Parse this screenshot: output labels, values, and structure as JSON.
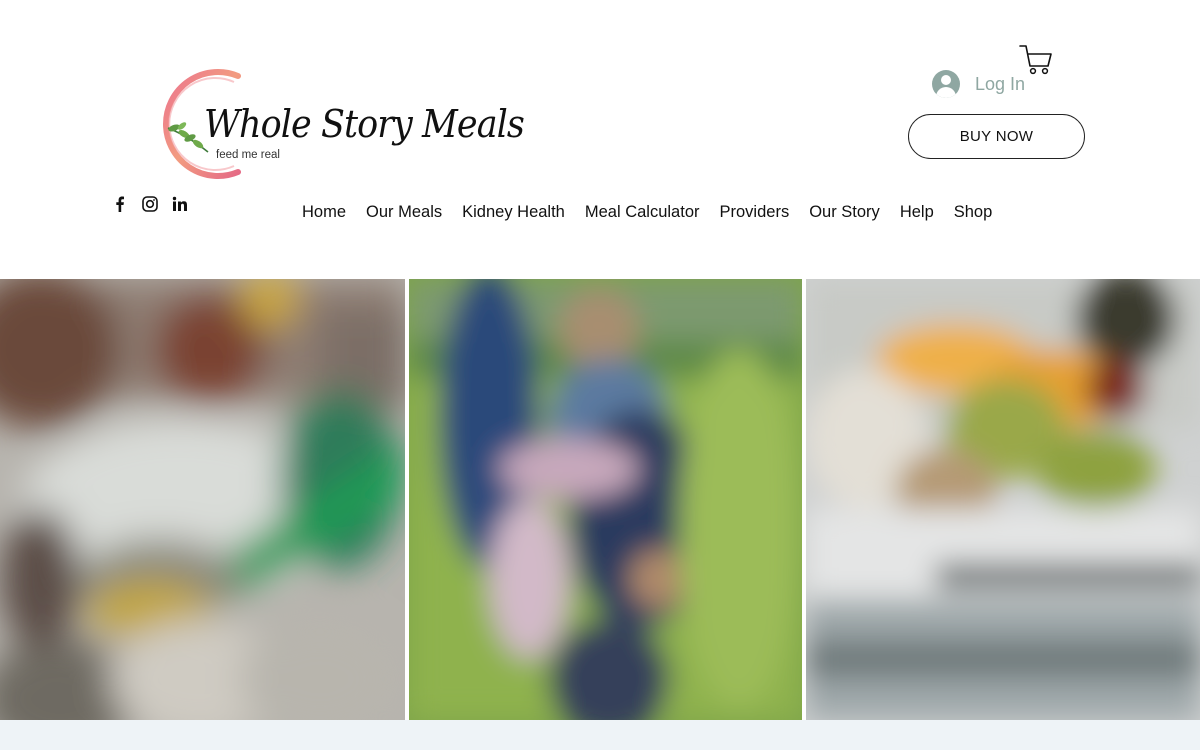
{
  "brand": {
    "name": "Whole Story Meals",
    "tagline": "feed me real"
  },
  "social": [
    {
      "name": "facebook-icon"
    },
    {
      "name": "instagram-icon"
    },
    {
      "name": "linkedin-icon"
    }
  ],
  "nav": {
    "items": [
      "Home",
      "Our Meals",
      "Kidney Health",
      "Meal Calculator",
      "Providers",
      "Our Story",
      "Help",
      "Shop"
    ]
  },
  "account": {
    "login_label": "Log In"
  },
  "cta": {
    "buy_now_label": "BUY NOW"
  },
  "gallery": {
    "images": [
      {
        "name": "gallery-image-meal-plate"
      },
      {
        "name": "gallery-image-family-park"
      },
      {
        "name": "gallery-image-fruit-table"
      }
    ]
  },
  "colors": {
    "accent": "#8fa7a2",
    "footer_strip": "#eef3f7"
  }
}
